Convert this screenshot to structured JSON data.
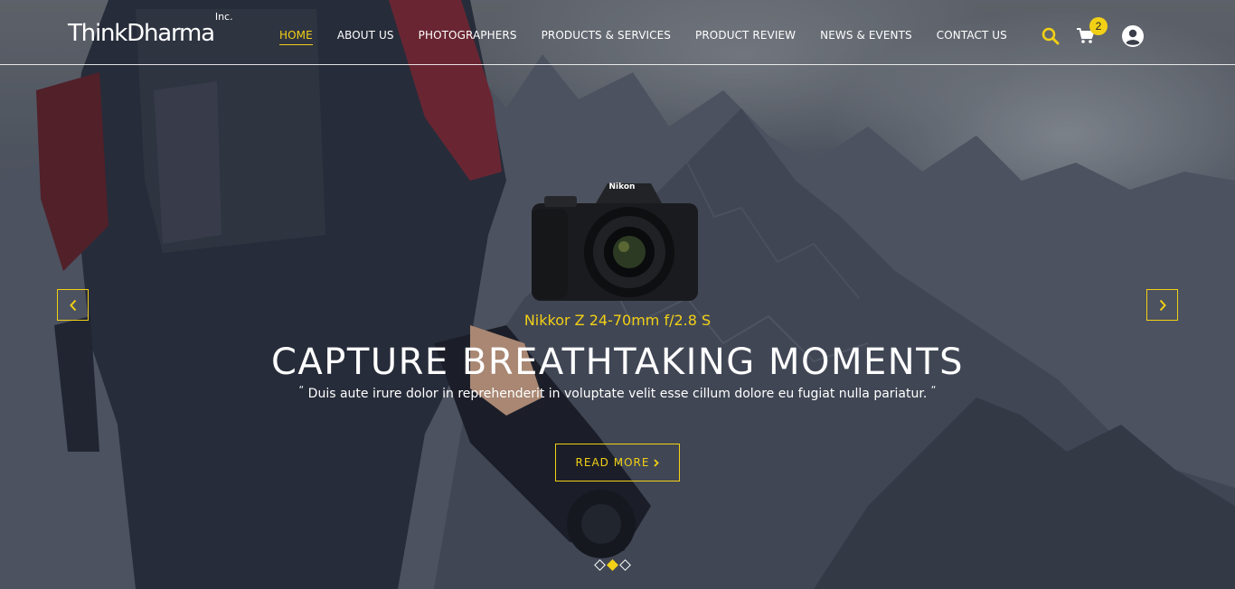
{
  "brand": {
    "name": "ThinkDharma",
    "suffix": "Inc."
  },
  "nav": {
    "items": [
      {
        "label": "HOME",
        "active": true
      },
      {
        "label": "ABOUT US",
        "active": false
      },
      {
        "label": "PHOTOGRAPHERS",
        "active": false
      },
      {
        "label": "PRODUCTS & SERVICES",
        "active": false
      },
      {
        "label": "PRODUCT REVIEW",
        "active": false
      },
      {
        "label": "NEWS & EVENTS",
        "active": false
      },
      {
        "label": "CONTACT US",
        "active": false
      }
    ]
  },
  "header_icons": {
    "search": "search-icon",
    "cart": "cart-icon",
    "user": "user-icon"
  },
  "cart": {
    "count": "2"
  },
  "slide": {
    "product_name": "Nikkor Z 24-70mm f/2.8 S",
    "camera_brand": "Nikon",
    "headline": "CAPTURE BREATHTAKING MOMENTS",
    "quote": "Duis aute irure dolor in reprehenderit in voluptate velit esse cillum dolore eu fugiat nulla pariatur.",
    "quote_open": "“",
    "quote_close": "“",
    "cta_label": "READ MORE",
    "cta_icon": "chevron-right-icon"
  },
  "slider": {
    "total_slides": 3,
    "active_slide": 2
  },
  "colors": {
    "accent": "#f2d016",
    "text": "#ffffff"
  }
}
